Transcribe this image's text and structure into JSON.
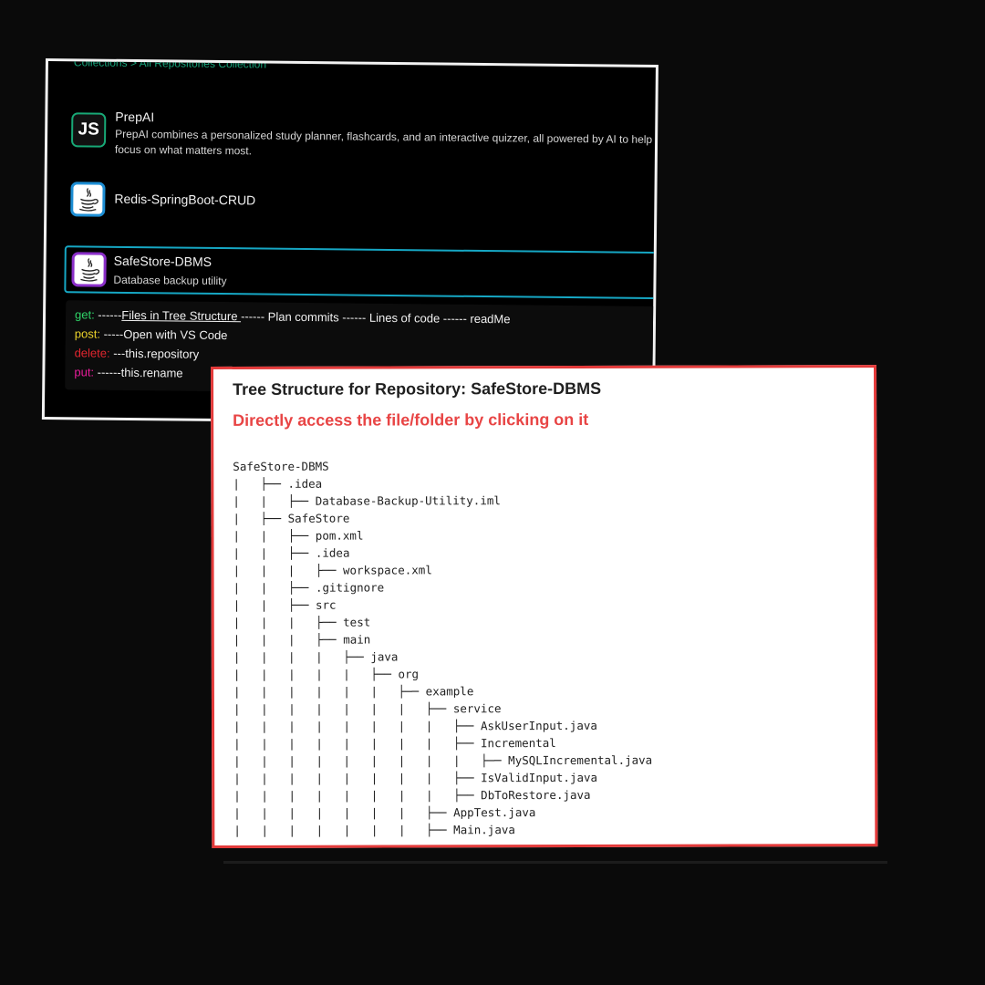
{
  "breadcrumb": "Collections  >  All Repositories Collection",
  "repositories": [
    {
      "name": "PrepAI",
      "logo": "js-icon",
      "logo_text": "JS",
      "description_line1": "PrepAI combines a personalized study planner, flashcards, and an interactive quizzer, all powered by AI to help",
      "description_line2": "focus on what matters most."
    },
    {
      "name": "Redis-SpringBoot-CRUD",
      "logo": "java-icon"
    },
    {
      "name": "SafeStore-DBMS",
      "logo": "java-icon",
      "description": "Database backup utility",
      "selected": true
    }
  ],
  "commands": {
    "get": {
      "keyword": "get:",
      "prefix": " ------",
      "link": "Files in Tree Structure ",
      "rest": "------ Plan commits ------ Lines of code ------ readMe"
    },
    "post": {
      "keyword": "post:",
      "text": " -----Open with VS Code"
    },
    "delete": {
      "keyword": "delete:",
      "text": " ---this.repository"
    },
    "put": {
      "keyword": "put:",
      "text": " ------this.rename"
    }
  },
  "tree_panel": {
    "title": "Tree Structure for Repository: SafeStore-DBMS",
    "subtitle": "Directly access the file/folder by clicking on it",
    "lines": [
      "SafeStore-DBMS",
      "|   ├── .idea",
      "|   |   ├── Database-Backup-Utility.iml",
      "|   ├── SafeStore",
      "|   |   ├── pom.xml",
      "|   |   ├── .idea",
      "|   |   |   ├── workspace.xml",
      "|   |   ├── .gitignore",
      "|   |   ├── src",
      "|   |   |   ├── test",
      "|   |   |   ├── main",
      "|   |   |   |   ├── java",
      "|   |   |   |   |   ├── org",
      "|   |   |   |   |   |   ├── example",
      "|   |   |   |   |   |   |   ├── service",
      "|   |   |   |   |   |   |   |   ├── AskUserInput.java",
      "|   |   |   |   |   |   |   |   ├── Incremental",
      "|   |   |   |   |   |   |   |   |   ├── MySQLIncremental.java",
      "|   |   |   |   |   |   |   |   ├── IsValidInput.java",
      "|   |   |   |   |   |   |   |   ├── DbToRestore.java",
      "|   |   |   |   |   |   |   ├── AppTest.java",
      "|   |   |   |   |   |   |   ├── Main.java"
    ]
  },
  "colors": {
    "accent_green": "#16a37a",
    "selected_border": "#16a7c4",
    "front_border": "#e33a3a",
    "subtitle_red": "#e84545"
  }
}
